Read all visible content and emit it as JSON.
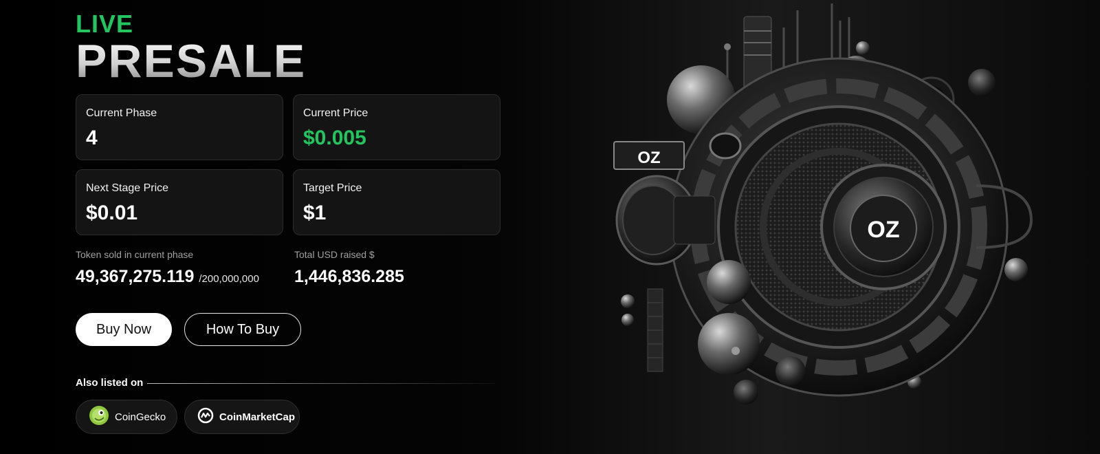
{
  "hero": {
    "live": "LIVE",
    "presale": "PRESALE"
  },
  "cards": [
    {
      "label": "Current Phase",
      "value": "4"
    },
    {
      "label": "Current Price",
      "value": "$0.005"
    },
    {
      "label": "Next Stage Price",
      "value": "$0.01"
    },
    {
      "label": "Target Price",
      "value": "$1"
    }
  ],
  "stats": {
    "sold_label": "Token sold in current phase",
    "sold_value": "49,367,275.119",
    "sold_total": "/200,000,000",
    "raised_label": "Total USD raised $",
    "raised_value": "1,446,836.285"
  },
  "buttons": {
    "buy": "Buy Now",
    "how": "How To Buy"
  },
  "listed": {
    "label": "Also listed on",
    "coingecko": "CoinGecko",
    "coinmarketcap": "CoinMarketCap"
  },
  "art": {
    "badge_small": "OZ",
    "badge_center": "OZ"
  },
  "colors": {
    "accent_green": "#22c55e",
    "background": "#000000"
  },
  "icons": [
    "coingecko-icon",
    "coinmarketcap-icon"
  ]
}
